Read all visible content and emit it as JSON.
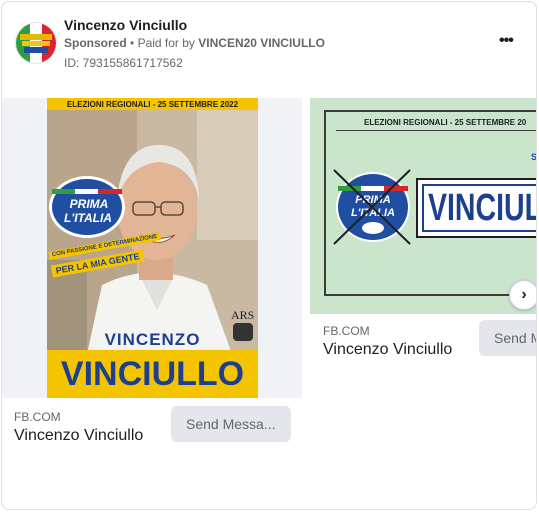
{
  "header": {
    "page_name": "Vincenzo Vinciullo",
    "sponsored_label": "Sponsored",
    "paid_prefix": "Paid for by",
    "paid_by": "VINCEN20 VINCIULLO",
    "ad_id": "ID: 793155861717562",
    "more_icon": "more-horizontal-icon"
  },
  "cards": [
    {
      "poster": {
        "banner": "ELEZIONI REGIONALI - 25 SETTEMBRE 2022",
        "party_line1": "PRIMA",
        "party_line2": "L'ITALIA",
        "slogan_line1": "CON PASSIONE E DETERMINAZIONE",
        "slogan_line2": "PER LA MIA GENTE",
        "ars": "ARS",
        "first_name": "VINCENZO",
        "last_name": "VINCIULLO"
      },
      "domain": "FB.COM",
      "title": "Vincenzo Vinciullo",
      "cta": "Send Messa..."
    },
    {
      "banner": "ELEZIONI REGIONALI - 25 SETTEMBRE 20",
      "party_line1": "PRIMA",
      "party_line2": "L'ITALIA",
      "name_box": "VINCIUL",
      "domain": "FB.COM",
      "title": "Vincenzo Vinciullo",
      "cta": "Send M"
    }
  ],
  "colors": {
    "poster_yellow": "#f5c400",
    "party_blue": "#1f4ea3",
    "name_blue": "#1d3f8f",
    "slide2_bg": "#cbe5cc"
  }
}
